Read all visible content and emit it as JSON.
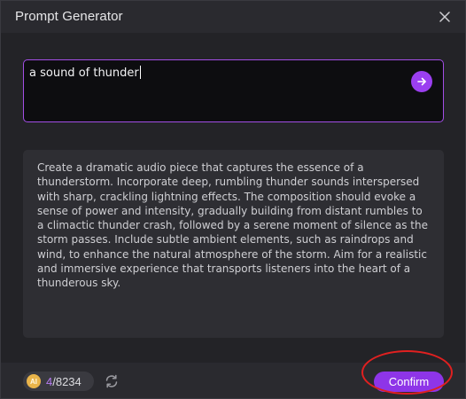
{
  "dialog": {
    "title": "Prompt Generator"
  },
  "prompt_input": {
    "value": "a sound of thunder"
  },
  "generated_output": {
    "text": "Create a dramatic audio piece that captures the essence of a thunderstorm. Incorporate deep, rumbling thunder sounds interspersed with sharp, crackling lightning effects. The composition should evoke a sense of power and intensity, gradually building from distant rumbles to a climactic thunder crash, followed by a serene moment of silence as the storm passes. Include subtle ambient elements, such as raindrops and wind, to enhance the natural atmosphere of the storm. Aim for a realistic and immersive experience that transports listeners into the heart of a thunderous sky."
  },
  "footer": {
    "ai_badge": "AI",
    "credits_used": "4",
    "credits_total": "/8234",
    "confirm_label": "Confirm"
  },
  "icons": {
    "close": "close-icon",
    "submit": "arrow-right-icon",
    "refresh": "refresh-icon",
    "ai": "ai-coin-icon"
  },
  "colors": {
    "accent": "#9b3ff0",
    "input_border": "#a24ee6",
    "highlight": "#e02020",
    "background": "#232327"
  }
}
